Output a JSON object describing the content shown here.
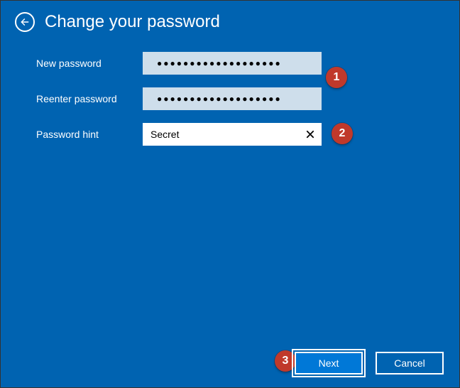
{
  "header": {
    "title": "Change your password"
  },
  "form": {
    "new_password_label": "New password",
    "reenter_password_label": "Reenter password",
    "hint_label": "Password hint",
    "new_password_value": "●●●●●●●●●●●●●●●●●●●",
    "reenter_password_value": "●●●●●●●●●●●●●●●●●●●",
    "hint_value": "Secret"
  },
  "footer": {
    "next_label": "Next",
    "cancel_label": "Cancel"
  },
  "annotations": {
    "b1": "1",
    "b2": "2",
    "b3": "3"
  }
}
